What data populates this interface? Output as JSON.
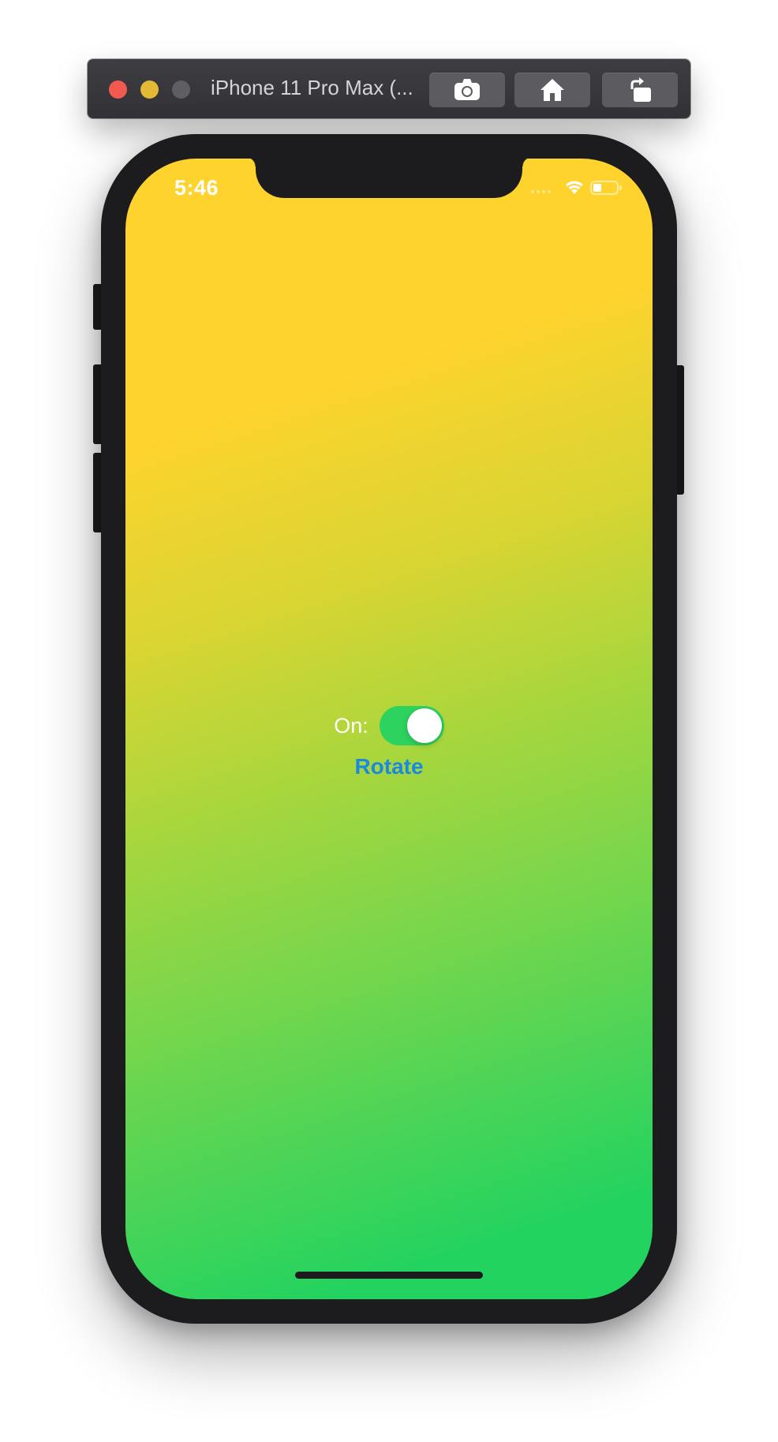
{
  "window": {
    "title": "iPhone 11 Pro Max (...",
    "buttons": [
      {
        "icon": "camera-icon",
        "action": "screenshot"
      },
      {
        "icon": "home-icon",
        "action": "home"
      },
      {
        "icon": "rotate-icon",
        "action": "rotate"
      }
    ]
  },
  "status_bar": {
    "time": "5:46",
    "icons": [
      "cellular-dots-icon",
      "wifi-icon",
      "battery-icon"
    ]
  },
  "content": {
    "switch_label": "On:",
    "switch_on": true,
    "rotate_label": "Rotate"
  },
  "colors": {
    "gradient_top": "#fed32d",
    "gradient_bottom": "#22d35f",
    "switch_on": "#2dd35e",
    "link": "#1a89df"
  }
}
